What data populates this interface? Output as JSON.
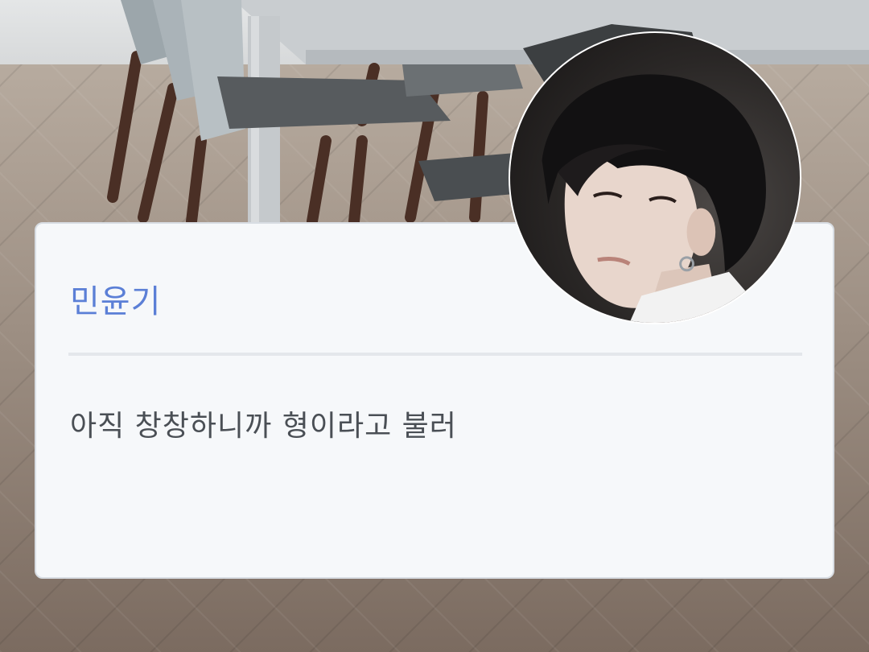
{
  "profile_card": {
    "name": "민윤기",
    "message": "아직 창창하니까 형이라고 불러"
  },
  "colors": {
    "name_text": "#5b7fd6",
    "message_text": "#4a4f55",
    "card_background": "#f6f8fa",
    "card_border": "#d8dde3",
    "divider": "#e4e7eb"
  },
  "images": {
    "background": "photo-dining-room-chairs-herringbone-floor",
    "avatar": "photo-profile-portrait"
  }
}
